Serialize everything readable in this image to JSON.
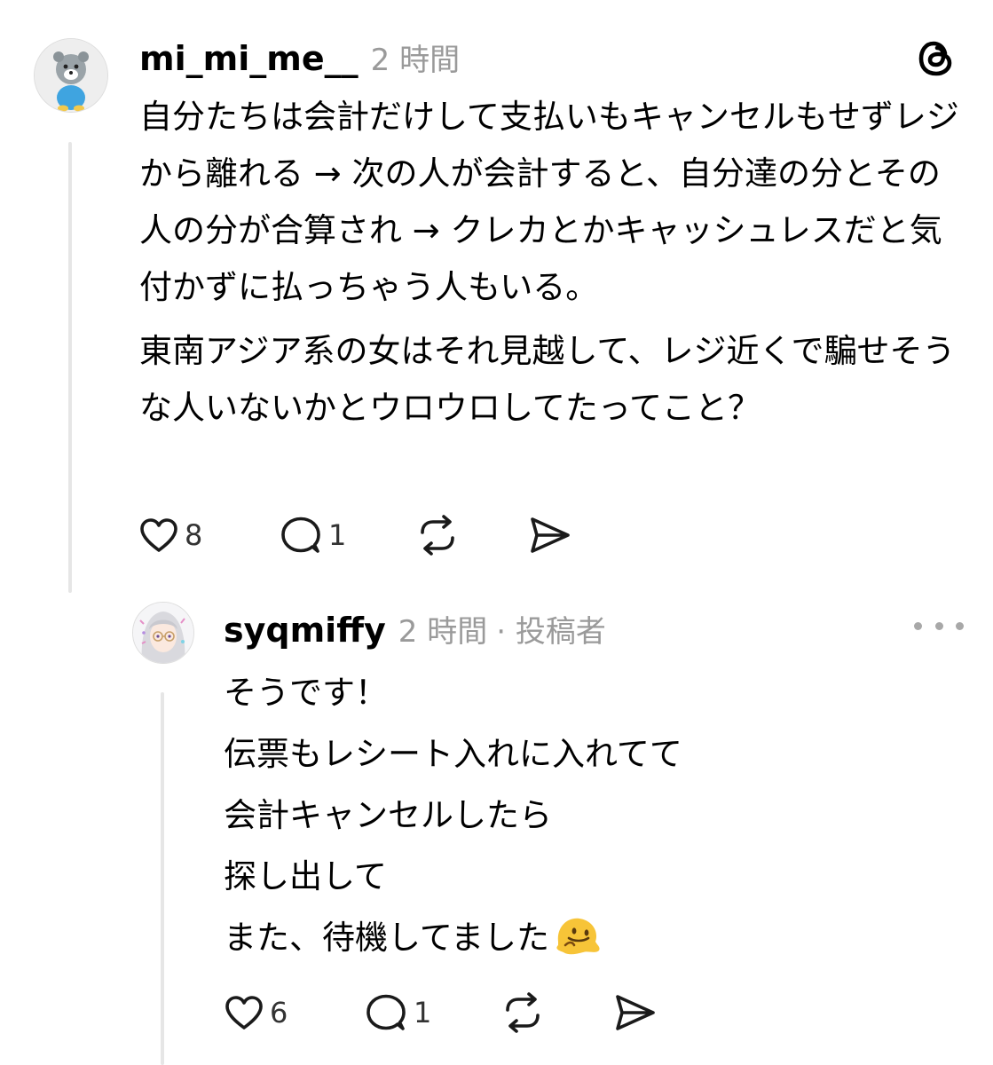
{
  "post": {
    "username": "mi_mi_me__",
    "time": "2 時間",
    "paragraphs": [
      "自分たちは会計だけして支払いもキャンセルもせずレジから離れる → 次の人が会計すると、自分達の分とその人の分が合算され → クレカとかキャッシュレスだと気付かずに払っちゃう人もいる。",
      "東南アジア系の女はそれ見越して、レジ近くで騙せそうな人いないかとウロウロしてたってこと？"
    ],
    "likes": "8",
    "replies": "1"
  },
  "reply": {
    "username": "syqmiffy",
    "time": "2 時間",
    "role": "· 投稿者",
    "lines": [
      "そうです！",
      "伝票もレシート入れに入れてて",
      "会計キャンセルしたら",
      "探し出して",
      "また、待機してました"
    ],
    "likes": "6",
    "replies": "1"
  },
  "icons": {
    "logo": "threads-logo-icon",
    "like": "heart-icon",
    "reply": "comment-icon",
    "repost": "repost-icon",
    "share": "share-icon",
    "more": "more-dots-icon",
    "emoji": "melting-face-emoji"
  },
  "colors": {
    "text": "#000000",
    "muted": "#9a9a9a",
    "thread_line": "#e6e6e6"
  }
}
